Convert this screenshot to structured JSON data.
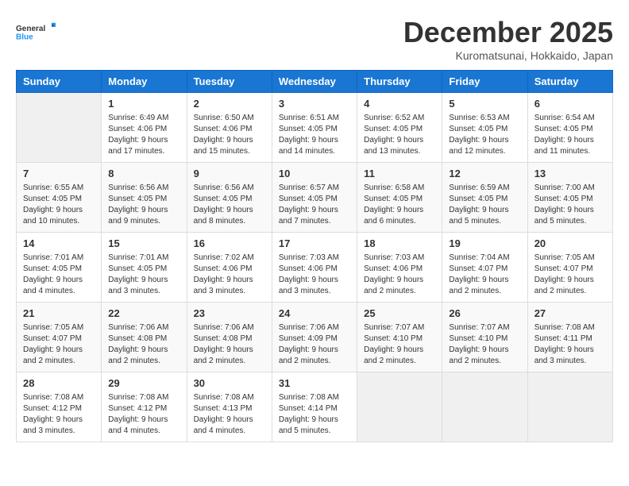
{
  "logo": {
    "general": "General",
    "blue": "Blue"
  },
  "header": {
    "month_year": "December 2025",
    "location": "Kuromatsunai, Hokkaido, Japan"
  },
  "weekdays": [
    "Sunday",
    "Monday",
    "Tuesday",
    "Wednesday",
    "Thursday",
    "Friday",
    "Saturday"
  ],
  "weeks": [
    [
      {
        "day": "",
        "info": ""
      },
      {
        "day": "1",
        "info": "Sunrise: 6:49 AM\nSunset: 4:06 PM\nDaylight: 9 hours\nand 17 minutes."
      },
      {
        "day": "2",
        "info": "Sunrise: 6:50 AM\nSunset: 4:06 PM\nDaylight: 9 hours\nand 15 minutes."
      },
      {
        "day": "3",
        "info": "Sunrise: 6:51 AM\nSunset: 4:05 PM\nDaylight: 9 hours\nand 14 minutes."
      },
      {
        "day": "4",
        "info": "Sunrise: 6:52 AM\nSunset: 4:05 PM\nDaylight: 9 hours\nand 13 minutes."
      },
      {
        "day": "5",
        "info": "Sunrise: 6:53 AM\nSunset: 4:05 PM\nDaylight: 9 hours\nand 12 minutes."
      },
      {
        "day": "6",
        "info": "Sunrise: 6:54 AM\nSunset: 4:05 PM\nDaylight: 9 hours\nand 11 minutes."
      }
    ],
    [
      {
        "day": "7",
        "info": "Sunrise: 6:55 AM\nSunset: 4:05 PM\nDaylight: 9 hours\nand 10 minutes."
      },
      {
        "day": "8",
        "info": "Sunrise: 6:56 AM\nSunset: 4:05 PM\nDaylight: 9 hours\nand 9 minutes."
      },
      {
        "day": "9",
        "info": "Sunrise: 6:56 AM\nSunset: 4:05 PM\nDaylight: 9 hours\nand 8 minutes."
      },
      {
        "day": "10",
        "info": "Sunrise: 6:57 AM\nSunset: 4:05 PM\nDaylight: 9 hours\nand 7 minutes."
      },
      {
        "day": "11",
        "info": "Sunrise: 6:58 AM\nSunset: 4:05 PM\nDaylight: 9 hours\nand 6 minutes."
      },
      {
        "day": "12",
        "info": "Sunrise: 6:59 AM\nSunset: 4:05 PM\nDaylight: 9 hours\nand 5 minutes."
      },
      {
        "day": "13",
        "info": "Sunrise: 7:00 AM\nSunset: 4:05 PM\nDaylight: 9 hours\nand 5 minutes."
      }
    ],
    [
      {
        "day": "14",
        "info": "Sunrise: 7:01 AM\nSunset: 4:05 PM\nDaylight: 9 hours\nand 4 minutes."
      },
      {
        "day": "15",
        "info": "Sunrise: 7:01 AM\nSunset: 4:05 PM\nDaylight: 9 hours\nand 3 minutes."
      },
      {
        "day": "16",
        "info": "Sunrise: 7:02 AM\nSunset: 4:06 PM\nDaylight: 9 hours\nand 3 minutes."
      },
      {
        "day": "17",
        "info": "Sunrise: 7:03 AM\nSunset: 4:06 PM\nDaylight: 9 hours\nand 3 minutes."
      },
      {
        "day": "18",
        "info": "Sunrise: 7:03 AM\nSunset: 4:06 PM\nDaylight: 9 hours\nand 2 minutes."
      },
      {
        "day": "19",
        "info": "Sunrise: 7:04 AM\nSunset: 4:07 PM\nDaylight: 9 hours\nand 2 minutes."
      },
      {
        "day": "20",
        "info": "Sunrise: 7:05 AM\nSunset: 4:07 PM\nDaylight: 9 hours\nand 2 minutes."
      }
    ],
    [
      {
        "day": "21",
        "info": "Sunrise: 7:05 AM\nSunset: 4:07 PM\nDaylight: 9 hours\nand 2 minutes."
      },
      {
        "day": "22",
        "info": "Sunrise: 7:06 AM\nSunset: 4:08 PM\nDaylight: 9 hours\nand 2 minutes."
      },
      {
        "day": "23",
        "info": "Sunrise: 7:06 AM\nSunset: 4:08 PM\nDaylight: 9 hours\nand 2 minutes."
      },
      {
        "day": "24",
        "info": "Sunrise: 7:06 AM\nSunset: 4:09 PM\nDaylight: 9 hours\nand 2 minutes."
      },
      {
        "day": "25",
        "info": "Sunrise: 7:07 AM\nSunset: 4:10 PM\nDaylight: 9 hours\nand 2 minutes."
      },
      {
        "day": "26",
        "info": "Sunrise: 7:07 AM\nSunset: 4:10 PM\nDaylight: 9 hours\nand 2 minutes."
      },
      {
        "day": "27",
        "info": "Sunrise: 7:08 AM\nSunset: 4:11 PM\nDaylight: 9 hours\nand 3 minutes."
      }
    ],
    [
      {
        "day": "28",
        "info": "Sunrise: 7:08 AM\nSunset: 4:12 PM\nDaylight: 9 hours\nand 3 minutes."
      },
      {
        "day": "29",
        "info": "Sunrise: 7:08 AM\nSunset: 4:12 PM\nDaylight: 9 hours\nand 4 minutes."
      },
      {
        "day": "30",
        "info": "Sunrise: 7:08 AM\nSunset: 4:13 PM\nDaylight: 9 hours\nand 4 minutes."
      },
      {
        "day": "31",
        "info": "Sunrise: 7:08 AM\nSunset: 4:14 PM\nDaylight: 9 hours\nand 5 minutes."
      },
      {
        "day": "",
        "info": ""
      },
      {
        "day": "",
        "info": ""
      },
      {
        "day": "",
        "info": ""
      }
    ]
  ]
}
